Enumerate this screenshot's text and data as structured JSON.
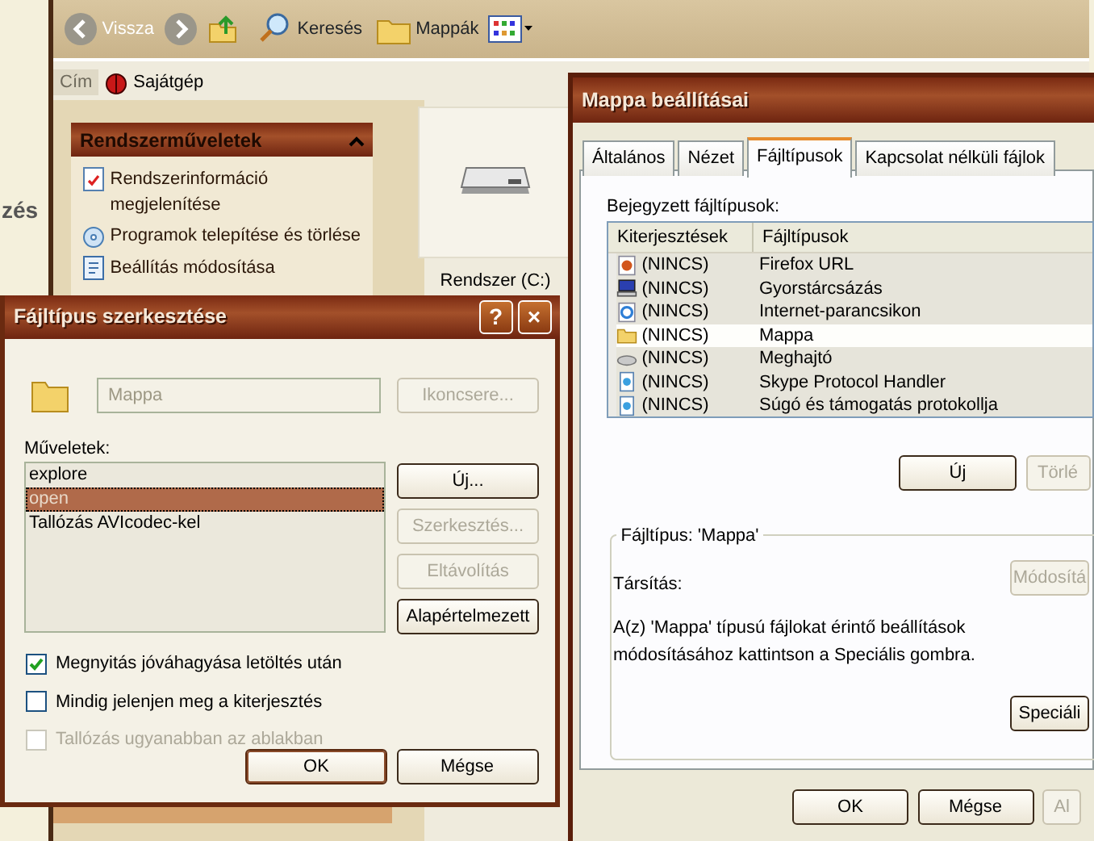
{
  "desktop_text": "zés",
  "explorer": {
    "toolbar": {
      "back": "Vissza",
      "search": "Keresés",
      "folders": "Mappák"
    },
    "address": {
      "label": "Cím",
      "value": "Sajátgép"
    },
    "task_panel": {
      "title": "Rendszerműveletek",
      "expanded": true,
      "items": [
        {
          "label": "Rendszerinformáció megjelenítése",
          "kind": "info"
        },
        {
          "label": "Programok telepítése és törlése",
          "kind": "programs"
        },
        {
          "label": "Beállítás módosítása",
          "kind": "settings"
        }
      ]
    },
    "drive": {
      "label": "Rendszer (C:)"
    }
  },
  "folder_options": {
    "title": "Mappa beállításai",
    "tabs": [
      {
        "label": "Általános",
        "selected": false
      },
      {
        "label": "Nézet",
        "selected": false
      },
      {
        "label": "Fájltípusok",
        "selected": true
      },
      {
        "label": "Kapcsolat nélküli fájlok",
        "selected": false
      }
    ],
    "registered_label": "Bejegyzett fájltípusok:",
    "columns": [
      "Kiterjesztések",
      "Fájltípusok"
    ],
    "rows": [
      {
        "extension": "(NINCS)",
        "type": "Firefox URL",
        "kind": "browser",
        "selected": false
      },
      {
        "extension": "(NINCS)",
        "type": "Gyorstárcsázás",
        "kind": "computer",
        "selected": false
      },
      {
        "extension": "(NINCS)",
        "type": "Internet-parancsikon",
        "kind": "web",
        "selected": false
      },
      {
        "extension": "(NINCS)",
        "type": "Mappa",
        "kind": "folder",
        "selected": true
      },
      {
        "extension": "(NINCS)",
        "type": "Meghajtó",
        "kind": "drive",
        "selected": false
      },
      {
        "extension": "(NINCS)",
        "type": "Skype Protocol Handler",
        "kind": "document",
        "selected": false
      },
      {
        "extension": "(NINCS)",
        "type": "Súgó és támogatás protokollja",
        "kind": "document",
        "selected": false
      }
    ],
    "list_buttons": [
      {
        "label": "Új",
        "disabled": false
      },
      {
        "label": "Törlé",
        "disabled": true
      }
    ],
    "group_title": "Fájltípus: 'Mappa'",
    "association_label": "Társítás:",
    "change_button": {
      "label": "Módosítá",
      "disabled": true
    },
    "description": "A(z) 'Mappa' típusú fájlokat érintő beállítások módosításához kattintson a Speciális gombra.",
    "advanced_button": {
      "label": "Speciáli",
      "disabled": false
    },
    "buttons": [
      {
        "label": "OK",
        "disabled": false
      },
      {
        "label": "Mégse",
        "disabled": false
      },
      {
        "label": "Al",
        "disabled": true
      }
    ]
  },
  "edit_dialog": {
    "title": "Fájltípus szerkesztése",
    "help": "?",
    "close": "×",
    "name_field": {
      "value": "Mappa",
      "disabled": true
    },
    "icon_button": {
      "label": "Ikoncsere...",
      "disabled": true
    },
    "actions_label": "Műveletek:",
    "actions": [
      {
        "label": "explore",
        "selected": false
      },
      {
        "label": "open",
        "selected": true
      },
      {
        "label": "Tallózás AVIcodec-kel",
        "selected": false
      }
    ],
    "action_buttons": [
      {
        "label": "Új...",
        "disabled": false
      },
      {
        "label": "Szerkesztés...",
        "disabled": true
      },
      {
        "label": "Eltávolítás",
        "disabled": true
      },
      {
        "label": "Alapértelmezett",
        "disabled": false
      }
    ],
    "checks": [
      {
        "label": "Megnyitás jóváhagyása letöltés után",
        "checked": true,
        "disabled": false
      },
      {
        "label": "Mindig jelenjen meg a kiterjesztés",
        "checked": false,
        "disabled": false
      },
      {
        "label": "Tallózás ugyanabban az ablakban",
        "checked": false,
        "disabled": true
      }
    ],
    "buttons": [
      {
        "label": "OK",
        "default": true
      },
      {
        "label": "Mégse",
        "default": false
      }
    ]
  }
}
